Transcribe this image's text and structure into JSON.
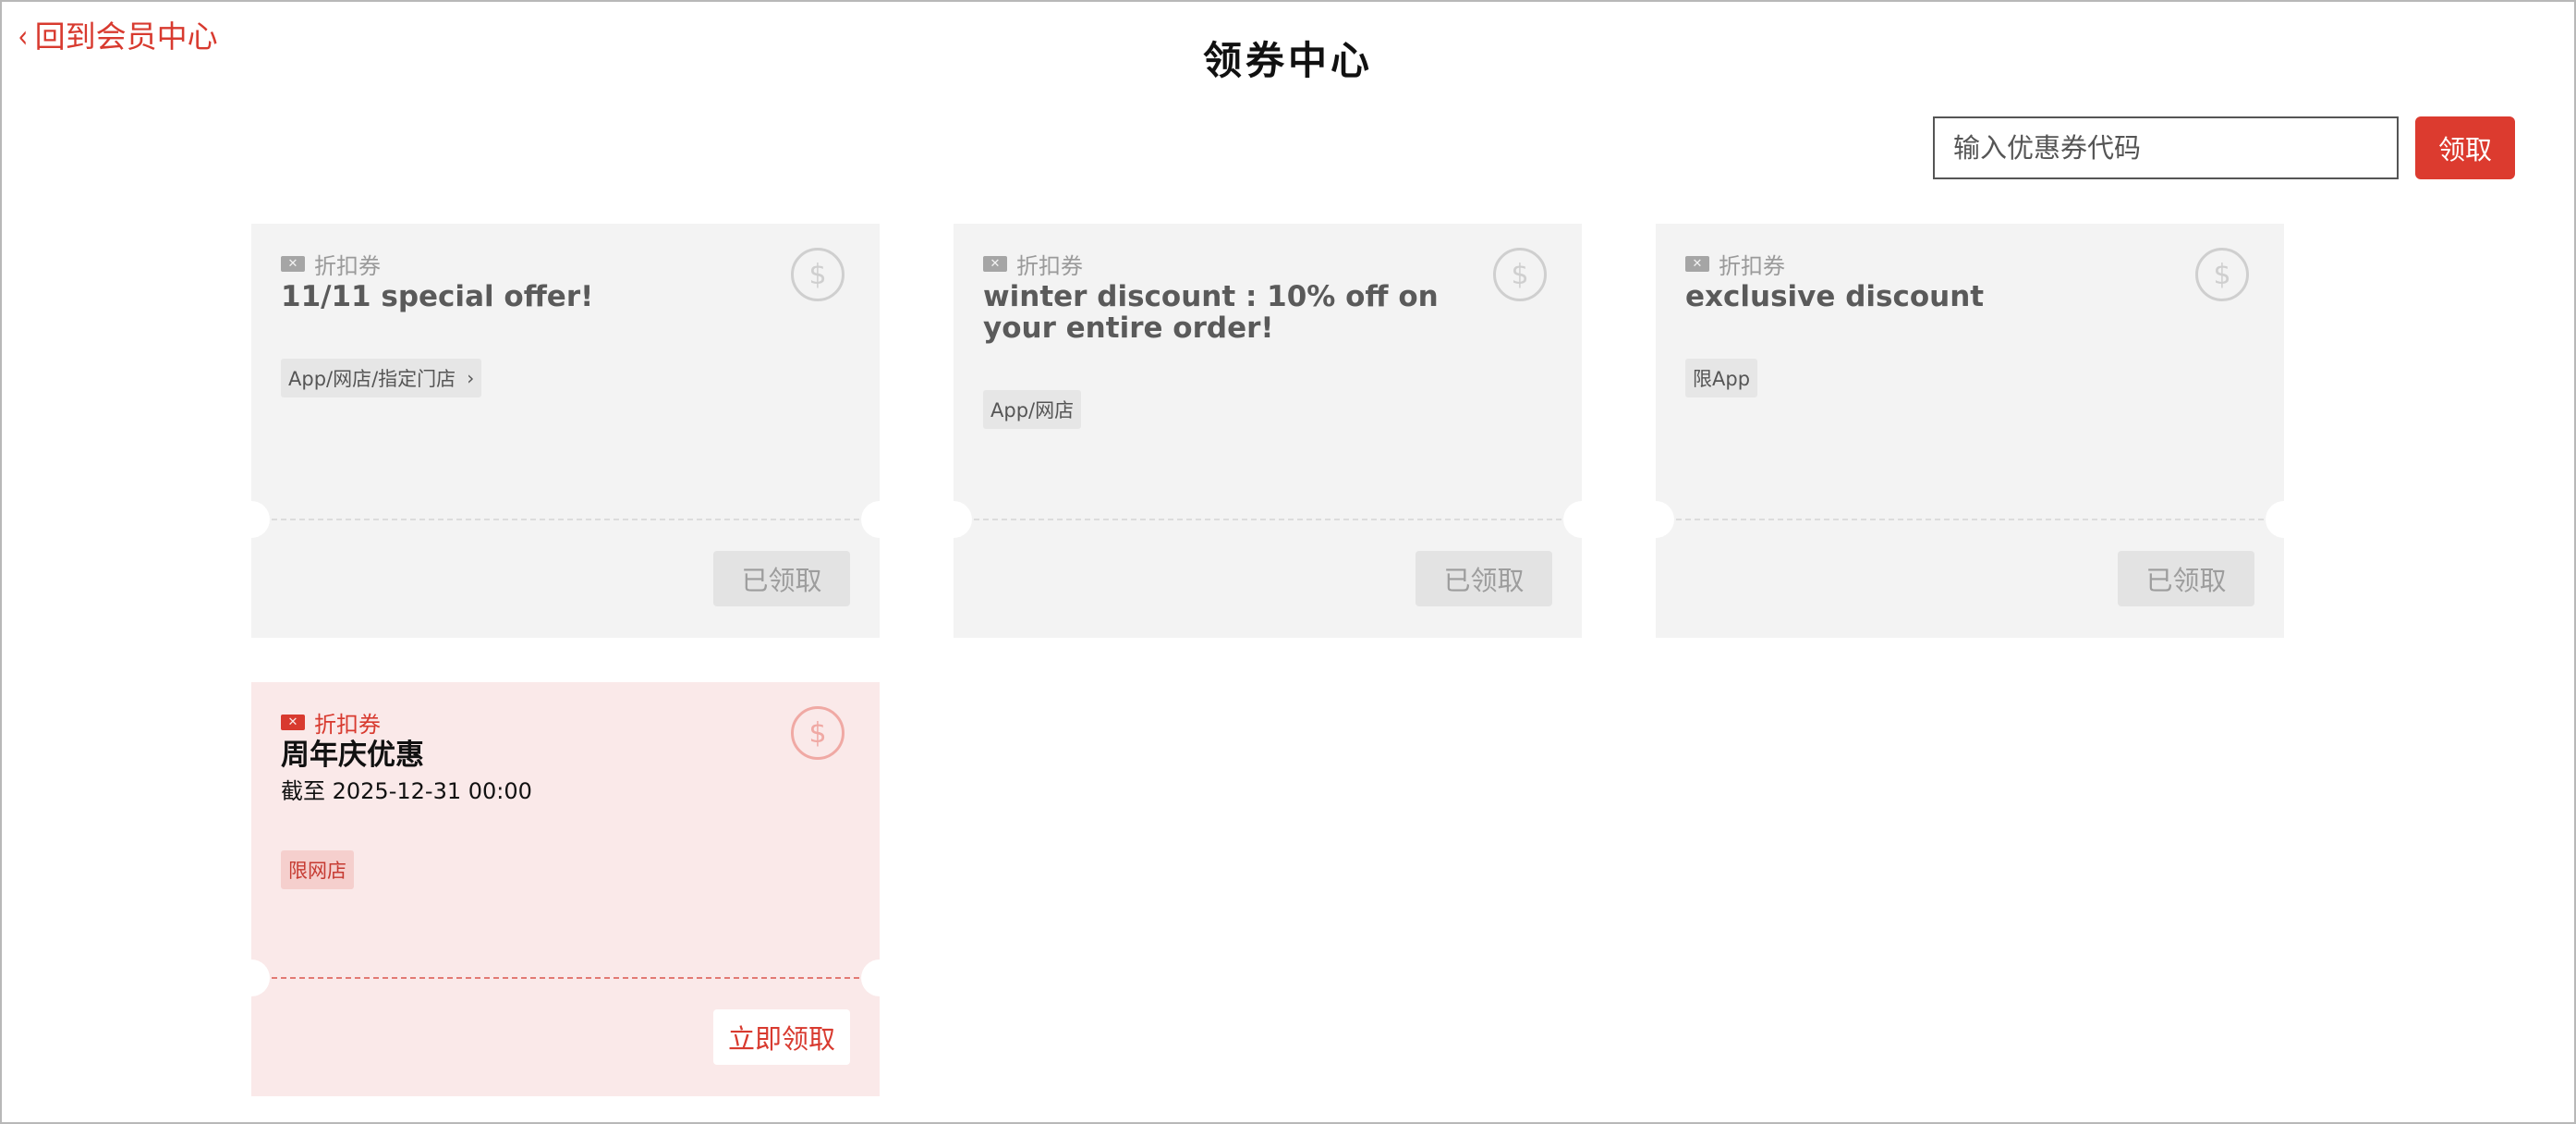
{
  "header": {
    "back_label": "回到会员中心",
    "title": "领券中心"
  },
  "code_entry": {
    "placeholder": "输入优惠券代码",
    "button_label": "领取"
  },
  "colors": {
    "accent": "#dc3b2f",
    "card_inactive": "#f3f3f3",
    "card_active": "#fae9e9"
  },
  "coupons": [
    {
      "type_label": "折扣券",
      "title": "11/11 special offer!",
      "tag": "App/网店/指定门店",
      "tag_has_chevron": true,
      "action_label": "已领取",
      "state": "claimed"
    },
    {
      "type_label": "折扣券",
      "title": "winter discount : 10% off on your entire order!",
      "tag": "App/网店",
      "action_label": "已领取",
      "state": "claimed"
    },
    {
      "type_label": "折扣券",
      "title": "exclusive discount",
      "tag": "限App",
      "action_label": "已领取",
      "state": "claimed"
    },
    {
      "type_label": "折扣券",
      "title": "周年庆优惠",
      "expiry": "截至 2025-12-31 00:00",
      "tag": "限网店",
      "action_label": "立即领取",
      "state": "available"
    }
  ]
}
